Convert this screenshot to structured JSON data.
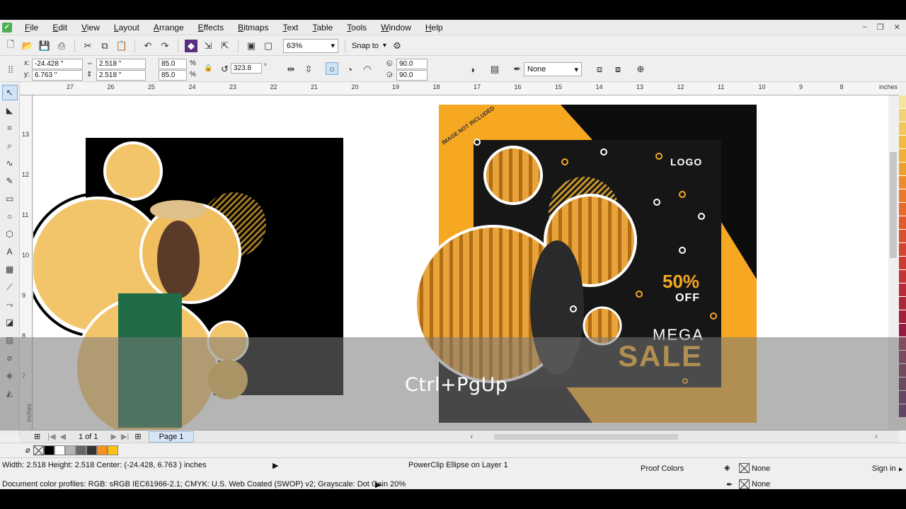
{
  "menu": [
    "File",
    "Edit",
    "View",
    "Layout",
    "Arrange",
    "Effects",
    "Bitmaps",
    "Text",
    "Table",
    "Tools",
    "Window",
    "Help"
  ],
  "toolbar": {
    "zoom": "63%",
    "snap_to": "Snap to"
  },
  "props": {
    "x": "-24.428 \"",
    "y": "6.763 \"",
    "w": "2.518 \"",
    "h": "2.518 \"",
    "scale_w": "85.0",
    "scale_h": "85.0",
    "pct": "%",
    "rotation": "323.8",
    "deg": "°",
    "angle1": "90.0",
    "angle2": "90.0",
    "outline": "None"
  },
  "ruler": {
    "h_labels": [
      "27",
      "26",
      "25",
      "24",
      "23",
      "22",
      "21",
      "20",
      "19",
      "18",
      "17",
      "16",
      "15",
      "14",
      "13",
      "12",
      "11",
      "10",
      "9",
      "8"
    ],
    "units": "inches",
    "v_labels": [
      "13",
      "12",
      "11",
      "10",
      "9",
      "8",
      "7"
    ],
    "v_units": "inches"
  },
  "pagebar": {
    "page_count": "1 of 1",
    "tab": "Page 1"
  },
  "design_right": {
    "ribbon": "IMAGE NOT INCLUDED",
    "logo": "LOGO",
    "percent": "50%",
    "off": "OFF",
    "mega": "MEGA",
    "sale": "SALE"
  },
  "status": {
    "dims": "Width: 2.518  Height: 2.518  Center: (-24.428, 6.763 )  inches",
    "object": "PowerClip Ellipse on Layer 1",
    "proof": "Proof Colors",
    "fill_none": "None",
    "outline_none": "None",
    "sign_in": "Sign in",
    "profiles": "Document color profiles: RGB: sRGB IEC61966-2.1; CMYK: U.S. Web Coated (SWOP) v2; Grayscale: Dot Gain 20%"
  },
  "overlay_text": "Ctrl+PgUp",
  "colors": {
    "gold": "#f7a823",
    "pale_gold": "#f3c56b",
    "black": "#0d0d0d",
    "swatches": [
      "#000000",
      "#ffffff",
      "#b3b3b3",
      "#666666",
      "#333333",
      "#f7931e",
      "#ffc20e"
    ],
    "palette": [
      "#f4e3a1",
      "#f2d27a",
      "#f1c75e",
      "#f0bb45",
      "#efaf39",
      "#ee9f31",
      "#ec8d2d",
      "#e97a2a",
      "#e66a2a",
      "#e05a2c",
      "#db4e2e",
      "#d44431",
      "#cc3b33",
      "#c43336",
      "#b82c39",
      "#ad263b",
      "#a2213d",
      "#961c3e",
      "#8a1840",
      "#7d1442",
      "#6f1144",
      "#600e45",
      "#510c46",
      "#430b47"
    ]
  }
}
